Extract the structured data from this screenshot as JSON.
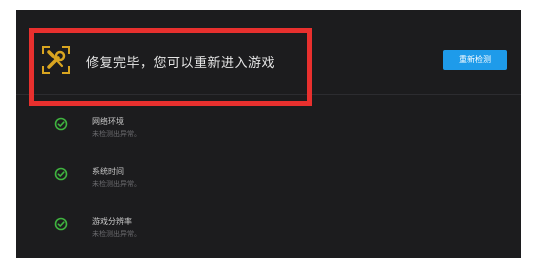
{
  "header": {
    "title": "修复完毕，您可以重新进入游戏",
    "recheck_label": "重新检测",
    "icon": "wrench-screwdriver-icon"
  },
  "checks": [
    {
      "name": "网络环境",
      "status": "未检测出异常。",
      "icon": "check-circle-icon"
    },
    {
      "name": "系统时间",
      "status": "未检测出异常。",
      "icon": "check-circle-icon"
    },
    {
      "name": "游戏分辨率",
      "status": "未检测出异常。",
      "icon": "check-circle-icon"
    }
  ],
  "colors": {
    "background": "#1c1c1e",
    "accent_button": "#1e9bea",
    "success": "#3fb33f",
    "icon_gold": "#d9a520",
    "highlight": "#e8302e"
  }
}
